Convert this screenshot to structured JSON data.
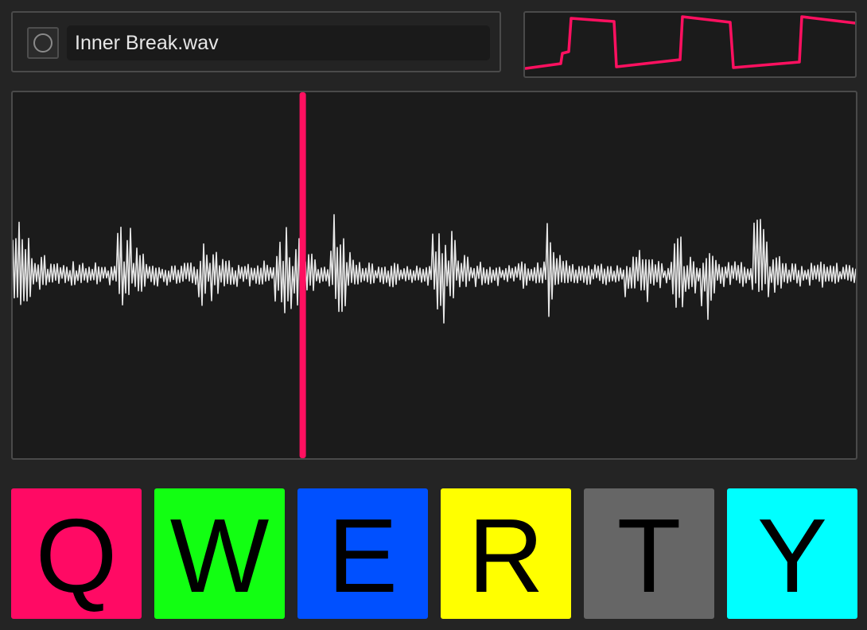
{
  "file": {
    "name": "Inner Break.wav"
  },
  "lfo": {
    "color": "#ff1060",
    "shape": "sawtooth-square-ramp"
  },
  "waveform": {
    "color": "#e8e8e8",
    "playhead_color": "#ff1060",
    "playhead_position": 0.344
  },
  "pads": [
    {
      "key": "Q",
      "color": "#ff0a64"
    },
    {
      "key": "W",
      "color": "#12ff12"
    },
    {
      "key": "E",
      "color": "#0050ff"
    },
    {
      "key": "R",
      "color": "#ffff00"
    },
    {
      "key": "T",
      "color": "#666666"
    },
    {
      "key": "Y",
      "color": "#00ffff"
    }
  ]
}
